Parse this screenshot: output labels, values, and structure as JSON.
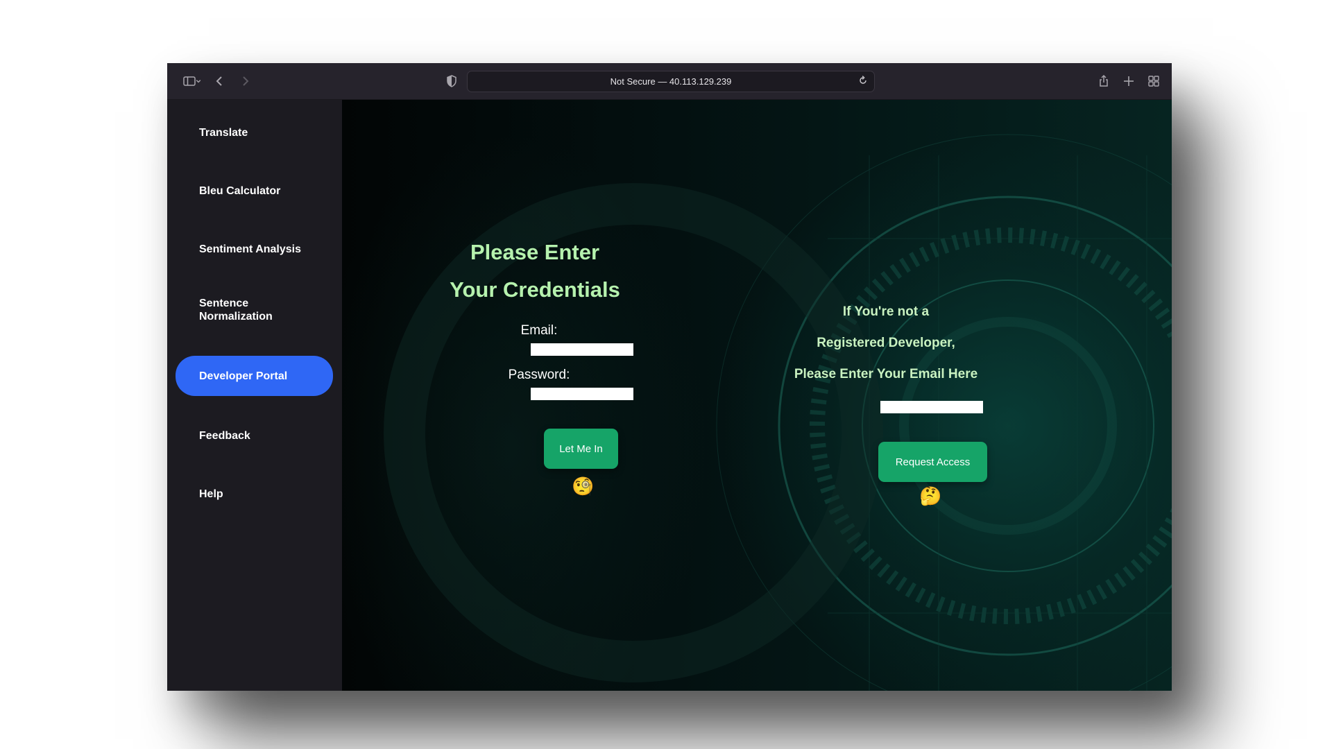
{
  "browser": {
    "url_text": "Not Secure — 40.113.129.239",
    "icons": [
      "sidebar-toggle-icon",
      "chevron-down-icon",
      "back-icon",
      "forward-icon",
      "shield-icon",
      "reload-icon",
      "share-icon",
      "new-tab-icon",
      "tab-overview-icon"
    ]
  },
  "sidebar": {
    "items": [
      {
        "label": "Translate",
        "active": false
      },
      {
        "label": "Bleu Calculator",
        "active": false
      },
      {
        "label": "Sentiment Analysis",
        "active": false
      },
      {
        "label": "Sentence Normalization",
        "active": false
      },
      {
        "label": "Developer Portal",
        "active": true
      },
      {
        "label": "Feedback",
        "active": false
      },
      {
        "label": "Help",
        "active": false
      }
    ]
  },
  "login": {
    "title_line1": "Please Enter",
    "title_line2": "Your Credentials",
    "email_label": "Email:",
    "email_value": "",
    "password_label": "Password:",
    "password_value": "",
    "submit_label": "Let Me In",
    "emoji": "🧐"
  },
  "request": {
    "line1": "If You're not a",
    "line2": "Registered Developer,",
    "line3": "Please Enter Your Email Here",
    "email_value": "",
    "submit_label": "Request Access",
    "emoji": "🤔"
  },
  "colors": {
    "accent_blue": "#2f67f5",
    "button_green": "#16a468",
    "title_green": "#b6f2ae"
  }
}
